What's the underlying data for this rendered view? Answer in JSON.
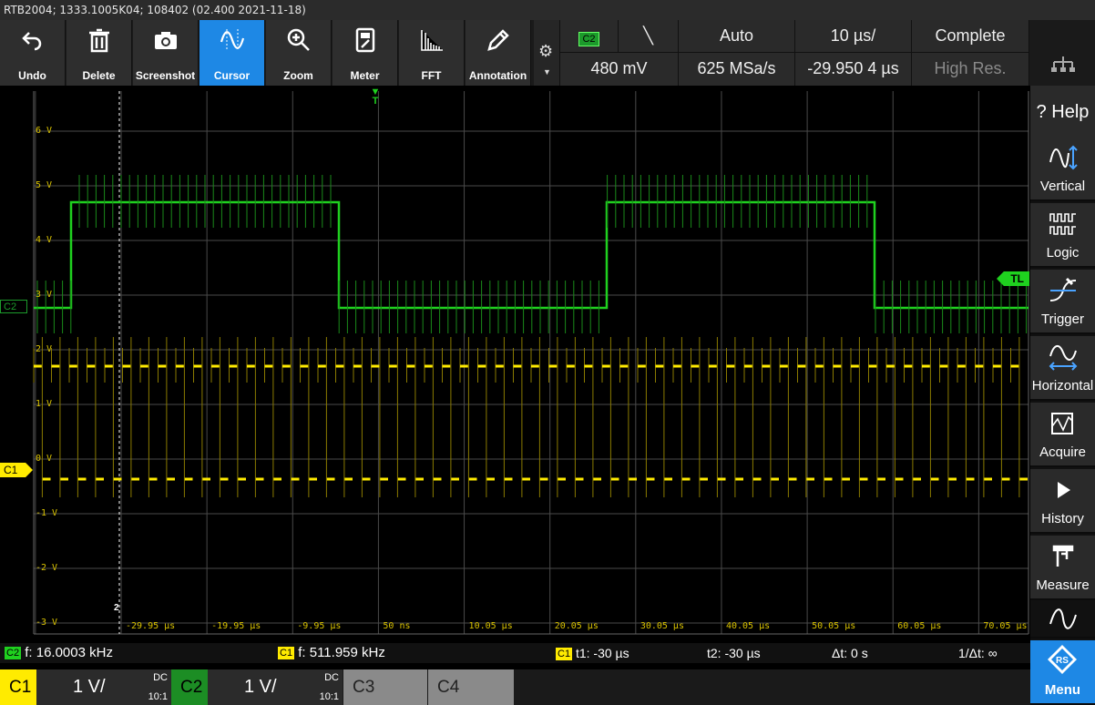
{
  "title_bar": "RTB2004; 1333.1005K04; 108402 (02.400 2021-11-18)",
  "toolbar": {
    "tools": [
      {
        "label": "Undo",
        "icon": "undo-icon"
      },
      {
        "label": "Delete",
        "icon": "trash-icon"
      },
      {
        "label": "Screenshot",
        "icon": "camera-icon"
      },
      {
        "label": "Cursor",
        "icon": "cursor-wave-icon",
        "active": true
      },
      {
        "label": "Zoom",
        "icon": "zoom-icon"
      },
      {
        "label": "Meter",
        "icon": "meter-icon"
      },
      {
        "label": "FFT",
        "icon": "fft-icon"
      },
      {
        "label": "Annotation",
        "icon": "pencil-icon"
      }
    ],
    "trigger_source": "C2",
    "trigger_slope": "╲",
    "trigger_mode": "Auto",
    "timebase": "10 µs/",
    "acq_state": "Complete",
    "trigger_level": "480 mV",
    "sample_rate": "625 MSa/s",
    "time_offset": "-29.950 4 µs",
    "resolution_mode": "High Res."
  },
  "sidebar": {
    "help": "? Help",
    "buttons": [
      "Vertical",
      "Logic",
      "Trigger",
      "Horizontal",
      "Acquire",
      "History",
      "Measure"
    ],
    "menu": "Menu"
  },
  "screen": {
    "volt_labels": [
      "6 V",
      "5 V",
      "4 V",
      "3 V",
      "2 V",
      "1 V",
      "0 V",
      "-1 V",
      "-2 V",
      "-3 V"
    ],
    "time_labels": [
      "-29.95 µs",
      "-19.95 µs",
      "-9.95 µs",
      "50 ns",
      "10.05 µs",
      "20.05 µs",
      "30.05 µs",
      "40.05 µs",
      "50.05 µs",
      "60.05 µs",
      "70.05 µs"
    ],
    "c2_tag": "C2",
    "c1_tag": "C1",
    "trigger_tag": "TL",
    "trigger_marker": "T",
    "cursor_marker": "2",
    "colors": {
      "c1": "#ffeb00",
      "c2": "#1fd11f",
      "accent": "#1e88e5"
    }
  },
  "measurements": {
    "c2_badge": "C2",
    "c2_freq": "f: 16.0003 kHz",
    "c1_badge": "C1",
    "c1_freq": "f: 511.959 kHz",
    "cursor_badge": "C1",
    "t1": "t1: -30 µs",
    "t2": "t2: -30 µs",
    "dt": "Δt: 0 s",
    "inv_dt": "1/Δt: ∞"
  },
  "channels": [
    {
      "name": "C1",
      "scale": "1 V/",
      "coupling": "DC",
      "ratio": "10:1"
    },
    {
      "name": "C2",
      "scale": "1 V/",
      "coupling": "DC",
      "ratio": "10:1"
    },
    {
      "name": "C3"
    },
    {
      "name": "C4"
    }
  ]
}
